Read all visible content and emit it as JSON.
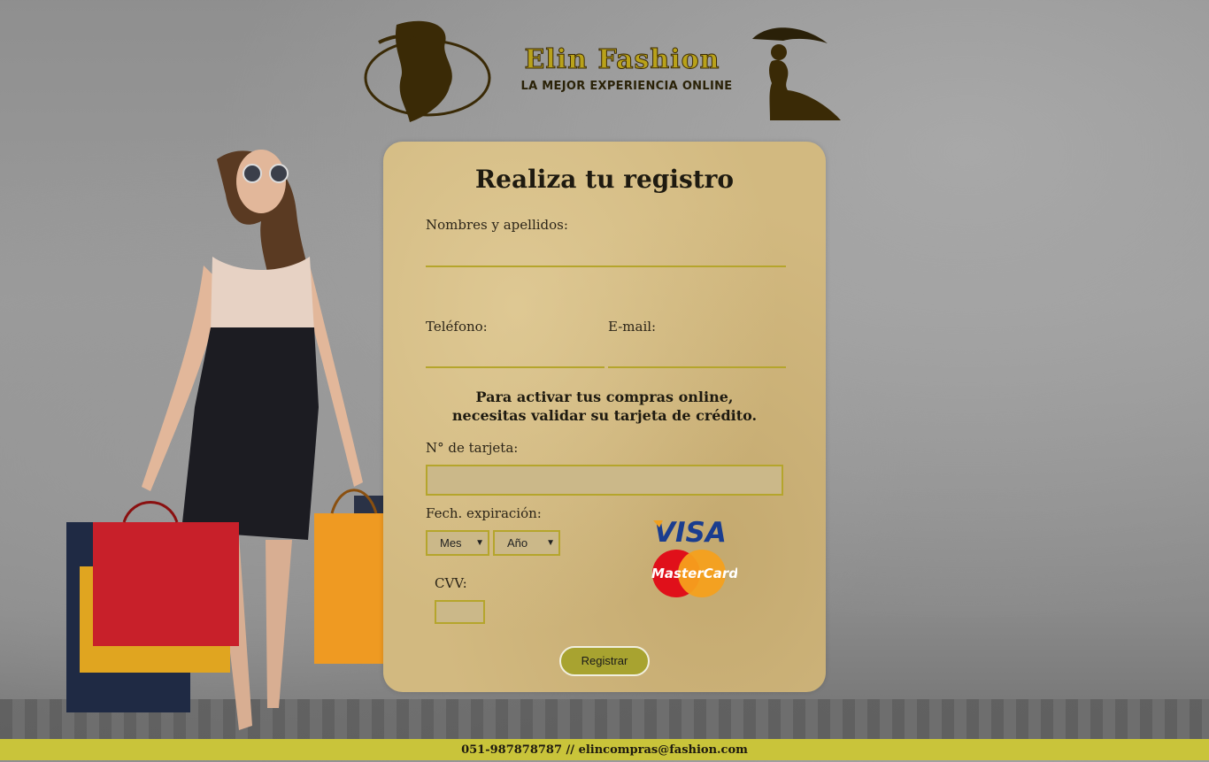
{
  "brand": {
    "name": "Elin Fashion",
    "tagline": "LA MEJOR EXPERIENCIA ONLINE"
  },
  "form": {
    "title": "Realiza tu registro",
    "name_label": "Nombres y apellidos:",
    "phone_label": "Teléfono:",
    "email_label": "E-mail:",
    "notice": "Para activar tus compras online, necesitas validar su tarjeta de crédito.",
    "card_number_label": "N° de tarjeta:",
    "expiry_label": "Fech. expiración:",
    "month_select": "Mes",
    "year_select": "Año",
    "cvv_label": "CVV:",
    "submit_label": "Registrar",
    "visa_text": "VISA",
    "mastercard_text": "MasterCard"
  },
  "footer": {
    "contact": "051-987878787 // elincompras@fashion.com"
  },
  "colors": {
    "accent": "#b5a52c",
    "card_bg": "#d2b980",
    "footer_bg": "#c9c43a",
    "button_bg": "#a8a330"
  }
}
